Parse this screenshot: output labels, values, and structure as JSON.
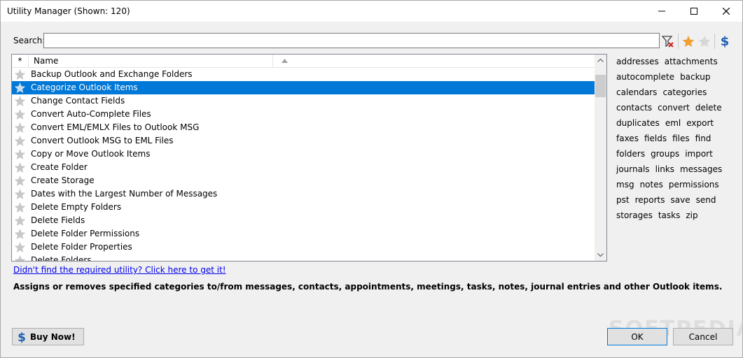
{
  "window": {
    "title": "Utility Manager (Shown: 120)"
  },
  "search": {
    "label": "Search:",
    "value": "",
    "placeholder": ""
  },
  "toolbar": {
    "icons": [
      "clear-filter-icon",
      "favorite-star-icon",
      "star-gray-icon",
      "dollar-icon"
    ]
  },
  "list": {
    "columns": {
      "star": "*",
      "name": "Name"
    },
    "selected_index": 1,
    "rows": [
      {
        "name": "Backup Outlook and Exchange Folders"
      },
      {
        "name": "Categorize Outlook Items"
      },
      {
        "name": "Change Contact Fields"
      },
      {
        "name": "Convert Auto-Complete Files"
      },
      {
        "name": "Convert EML/EMLX Files to Outlook MSG"
      },
      {
        "name": "Convert Outlook MSG to EML Files"
      },
      {
        "name": "Copy or Move Outlook Items"
      },
      {
        "name": "Create Folder"
      },
      {
        "name": "Create Storage"
      },
      {
        "name": "Dates with the Largest Number of Messages"
      },
      {
        "name": "Delete Empty Folders"
      },
      {
        "name": "Delete Fields"
      },
      {
        "name": "Delete Folder Permissions"
      },
      {
        "name": "Delete Folder Properties"
      },
      {
        "name": "Delete Folders"
      }
    ]
  },
  "tags": [
    [
      "addresses",
      "attachments"
    ],
    [
      "autocomplete",
      "backup"
    ],
    [
      "calendars",
      "categories"
    ],
    [
      "contacts",
      "convert",
      "delete"
    ],
    [
      "duplicates",
      "eml",
      "export"
    ],
    [
      "faxes",
      "fields",
      "files",
      "find"
    ],
    [
      "folders",
      "groups",
      "import"
    ],
    [
      "journals",
      "links",
      "messages"
    ],
    [
      "msg",
      "notes",
      "permissions"
    ],
    [
      "pst",
      "reports",
      "save",
      "send"
    ],
    [
      "storages",
      "tasks",
      "zip"
    ]
  ],
  "help_link": "Didn't find the required utility? Click here to get it!",
  "description": "Assigns or removes specified categories to/from messages, contacts, appointments, meetings, tasks, notes, journal entries and other Outlook items.",
  "buttons": {
    "buy_now": "Buy Now!",
    "ok": "OK",
    "cancel": "Cancel"
  },
  "colors": {
    "selection": "#0078d7",
    "star_gray": "#c8c8c8",
    "star_gold": "#f0a030",
    "dollar": "#1f5fb4"
  },
  "watermark": "SOFTPEDIA"
}
